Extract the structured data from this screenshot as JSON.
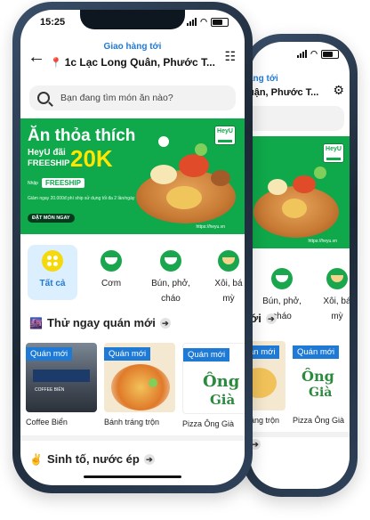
{
  "status": {
    "time": "15:25"
  },
  "header": {
    "deliver_label": "Giao hàng tới",
    "address_front": "1c Lạc Long Quân, Phước T...",
    "address_back": "uận, Phước T..."
  },
  "search": {
    "placeholder": "Bạn đang tìm món ăn nào?"
  },
  "banner": {
    "headline": "Ăn thỏa thích",
    "subline": "HeyU đãi",
    "freeship": "FREESHIP",
    "amount": "20K",
    "enter_code": "Nhập",
    "code": "FREESHIP",
    "fine_print": "Giảm ngay 20.000đ phí ship sử dụng tối đa 2 lần/ngày",
    "cta": "ĐẶT MÓN NGAY",
    "url": "https://heyu.vn",
    "brand": "HeyU"
  },
  "categories": [
    {
      "label": "Tất cả"
    },
    {
      "label": "Cơm"
    },
    {
      "label_1": "Bún, phở,",
      "label_2": "cháo"
    },
    {
      "label_1": "Xôi, bá",
      "label_2": "mỳ"
    }
  ],
  "sections": {
    "new_shops": "Thử ngay quán mới",
    "drinks": "Sinh tố, nước ép"
  },
  "shops": [
    {
      "badge": "Quán mới",
      "name": "Coffee Biển",
      "sign": "COFFEE BIỂN"
    },
    {
      "badge": "Quán mới",
      "name": "Bánh tráng trộn"
    },
    {
      "badge": "Quán mới",
      "name": "Pizza Ông Già",
      "logo_word": "Ông",
      "logo_word2": "Già"
    }
  ],
  "back_phone": {
    "categories": [
      {
        "label_1": "Bún, phở,",
        "label_2": "cháo"
      },
      {
        "label_1": "Xôi, bá",
        "label_2": "mỳ"
      }
    ],
    "section_tail": "ới",
    "shop_names": [
      "áng trộn",
      "Pizza Ông Già"
    ]
  },
  "colors": {
    "brand_green": "#0fa84a",
    "accent_blue": "#1f7ad6",
    "highlight_yellow": "#ffe600"
  }
}
